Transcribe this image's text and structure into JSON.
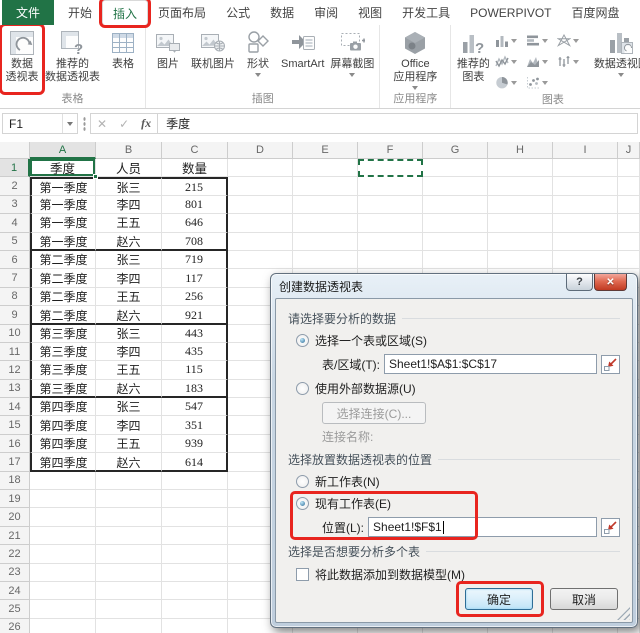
{
  "ribbon": {
    "tabs": [
      {
        "label": "文件"
      },
      {
        "label": "开始"
      },
      {
        "label": "插入"
      },
      {
        "label": "页面布局"
      },
      {
        "label": "公式"
      },
      {
        "label": "数据"
      },
      {
        "label": "审阅"
      },
      {
        "label": "视图"
      },
      {
        "label": "开发工具"
      },
      {
        "label": "POWERPIVOT"
      },
      {
        "label": "百度网盘"
      }
    ],
    "tables_label": "表格",
    "illustrations_label": "插图",
    "apps_label": "应用程序",
    "charts_label": "图表",
    "buttons": {
      "pivottable": {
        "l1": "数据",
        "l2": "透视表"
      },
      "recommended_pivottable": {
        "l1": "推荐的",
        "l2": "数据透视表"
      },
      "table": {
        "l1": "表格"
      },
      "pictures": {
        "l1": "图片"
      },
      "online_pictures": {
        "l1": "联机图片"
      },
      "shapes": {
        "l1": "形状"
      },
      "smartart": {
        "l1": "SmartArt"
      },
      "screenshot": {
        "l1": "屏幕截图"
      },
      "office_apps": {
        "l1": "Office",
        "l2": "应用程序"
      },
      "recommended_charts": {
        "l1": "推荐的",
        "l2": "图表"
      },
      "pivotchart": {
        "l1": "数据透视图"
      }
    },
    "chart_type_icons": [
      "column-chart-icon",
      "bar-chart-icon",
      "radar-chart-icon",
      "line-chart-icon",
      "area-chart-icon",
      "stock-chart-icon",
      "pie-chart-icon",
      "scatter-chart-icon"
    ]
  },
  "formula_bar": {
    "name_box": "F1",
    "cancel_glyph": "✕",
    "enter_glyph": "✓",
    "fx_glyph": "fx",
    "value": "季度"
  },
  "sheet": {
    "col_headers": [
      "A",
      "B",
      "C",
      "D",
      "E",
      "F",
      "G",
      "H",
      "I",
      "J"
    ],
    "row_count": 26,
    "active_cell": "A1",
    "destination_cell": "F1",
    "data": [
      [
        "季度",
        "人员",
        "数量"
      ],
      [
        "第一季度",
        "张三",
        "215"
      ],
      [
        "第一季度",
        "李四",
        "801"
      ],
      [
        "第一季度",
        "王五",
        "646"
      ],
      [
        "第一季度",
        "赵六",
        "708"
      ],
      [
        "第二季度",
        "张三",
        "719"
      ],
      [
        "第二季度",
        "李四",
        "117"
      ],
      [
        "第二季度",
        "王五",
        "256"
      ],
      [
        "第二季度",
        "赵六",
        "921"
      ],
      [
        "第三季度",
        "张三",
        "443"
      ],
      [
        "第三季度",
        "李四",
        "435"
      ],
      [
        "第三季度",
        "王五",
        "115"
      ],
      [
        "第三季度",
        "赵六",
        "183"
      ],
      [
        "第四季度",
        "张三",
        "547"
      ],
      [
        "第四季度",
        "李四",
        "351"
      ],
      [
        "第四季度",
        "王五",
        "939"
      ],
      [
        "第四季度",
        "赵六",
        "614"
      ]
    ],
    "group_break_rows": [
      5,
      9,
      13
    ]
  },
  "dialog": {
    "title": "创建数据透视表",
    "help_glyph": "?",
    "close_glyph": "✕",
    "section_choose_data": "请选择要分析的数据",
    "radio_select_range": "选择一个表或区域(S)",
    "range_label": "表/区域(T):",
    "range_value": "Sheet1!$A$1:$C$17",
    "radio_external": "使用外部数据源(U)",
    "choose_connection_button": "选择连接(C)...",
    "connection_name_label": "连接名称:",
    "section_placement": "选择放置数据透视表的位置",
    "radio_new_worksheet": "新工作表(N)",
    "radio_existing_worksheet": "现有工作表(E)",
    "location_label": "位置(L):",
    "location_value": "Sheet1!$F$1",
    "section_multi": "选择是否想要分析多个表",
    "checkbox_data_model": "将此数据添加到数据模型(M)",
    "ok_button": "确定",
    "cancel_button": "取消"
  },
  "annotations": {
    "color": "#e8251f",
    "targets": [
      "insert-tab",
      "pivottable-button",
      "existing-worksheet-option",
      "ok-button"
    ]
  }
}
